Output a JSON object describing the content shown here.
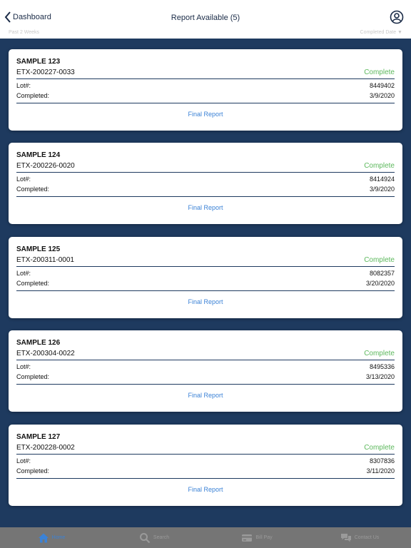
{
  "header": {
    "back_label": "Dashboard",
    "title": "Report Available (5)",
    "filter_left": "Past 2 Weeks",
    "filter_right": "Completed Date ▼"
  },
  "colors": {
    "background": "#1e3a5f",
    "status_complete": "#5cb85c",
    "link": "#3b82d6"
  },
  "cards": [
    {
      "sample": "SAMPLE 123",
      "id": "ETX-200227-0033",
      "status": "Complete",
      "lot_label": "Lot#:",
      "lot": "8449402",
      "completed_label": "Completed:",
      "completed": "3/9/2020",
      "report_label": "Final Report"
    },
    {
      "sample": "SAMPLE 124",
      "id": "ETX-200226-0020",
      "status": "Complete",
      "lot_label": "Lot#:",
      "lot": "8414924",
      "completed_label": "Completed:",
      "completed": "3/9/2020",
      "report_label": "Final Report"
    },
    {
      "sample": "SAMPLE 125",
      "id": "ETX-200311-0001",
      "status": "Complete",
      "lot_label": "Lot#:",
      "lot": "8082357",
      "completed_label": "Completed:",
      "completed": "3/20/2020",
      "report_label": "Final Report"
    },
    {
      "sample": "SAMPLE 126",
      "id": "ETX-200304-0022",
      "status": "Complete",
      "lot_label": "Lot#:",
      "lot": "8495336",
      "completed_label": "Completed:",
      "completed": "3/13/2020",
      "report_label": "Final Report"
    },
    {
      "sample": "SAMPLE 127",
      "id": "ETX-200228-0002",
      "status": "Complete",
      "lot_label": "Lot#:",
      "lot": "8307836",
      "completed_label": "Completed:",
      "completed": "3/11/2020",
      "report_label": "Final Report"
    }
  ],
  "tabbar": {
    "items": [
      {
        "label": "Home",
        "icon": "home-icon",
        "active": true
      },
      {
        "label": "Search",
        "icon": "search-icon",
        "active": false
      },
      {
        "label": "Bill Pay",
        "icon": "credit-card-icon",
        "active": false
      },
      {
        "label": "Contact Us",
        "icon": "chat-bubbles-icon",
        "active": false
      }
    ]
  }
}
